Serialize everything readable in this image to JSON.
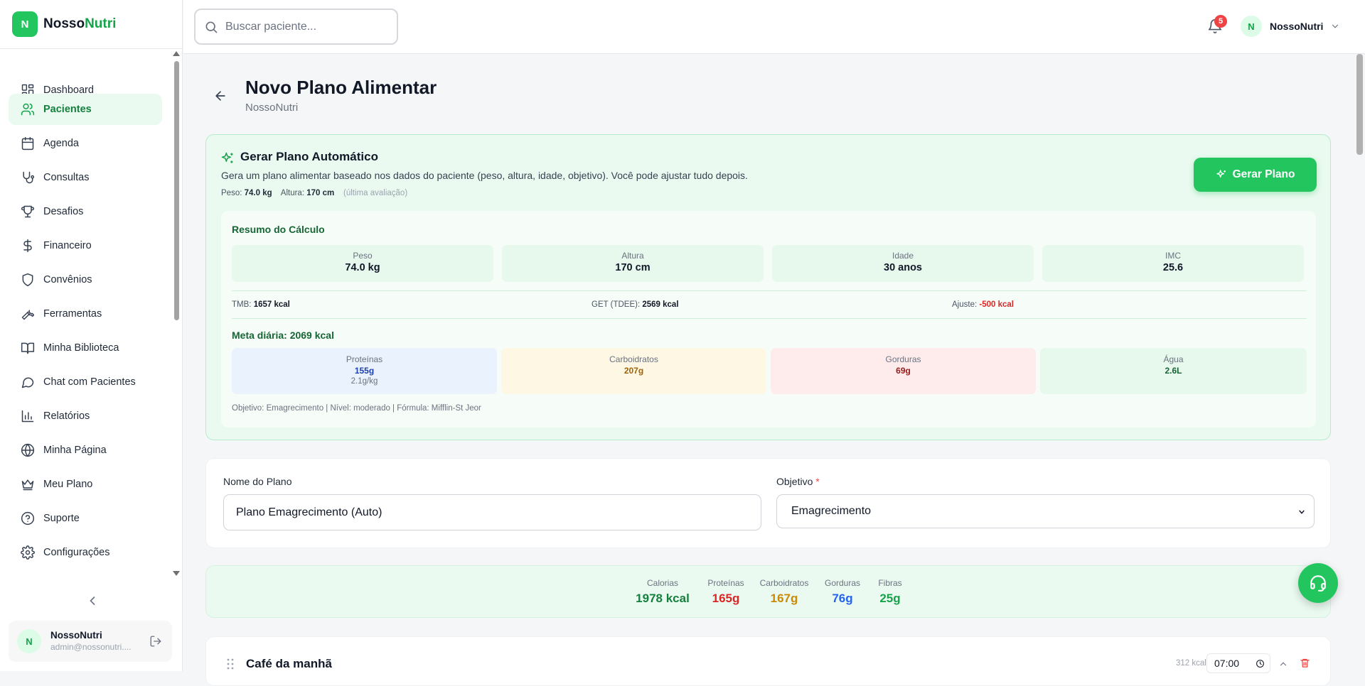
{
  "brand": {
    "logo_letter": "N",
    "name_part1": "Nosso",
    "name_part2": "Nutri"
  },
  "sidebar": {
    "items": [
      {
        "label": "Dashboard",
        "icon": "grid-icon"
      },
      {
        "label": "Pacientes",
        "icon": "users-icon",
        "active": true
      },
      {
        "label": "Agenda",
        "icon": "calendar-icon"
      },
      {
        "label": "Consultas",
        "icon": "stethoscope-icon"
      },
      {
        "label": "Desafios",
        "icon": "trophy-icon"
      },
      {
        "label": "Financeiro",
        "icon": "dollar-icon"
      },
      {
        "label": "Convênios",
        "icon": "shield-icon"
      },
      {
        "label": "Ferramentas",
        "icon": "wrench-icon"
      },
      {
        "label": "Minha Biblioteca",
        "icon": "book-icon"
      },
      {
        "label": "Chat com Pacientes",
        "icon": "chat-icon"
      },
      {
        "label": "Relatórios",
        "icon": "bar-chart-icon"
      },
      {
        "label": "Minha Página",
        "icon": "globe-icon"
      },
      {
        "label": "Meu Plano",
        "icon": "crown-icon"
      },
      {
        "label": "Suporte",
        "icon": "help-circle-icon"
      },
      {
        "label": "Configurações",
        "icon": "gear-icon"
      }
    ],
    "user": {
      "initial": "N",
      "name": "NossoNutri",
      "email": "admin@nossonutri...."
    }
  },
  "topbar": {
    "search_placeholder": "Buscar paciente...",
    "notifications_count": "5",
    "user_initial": "N",
    "user_name": "NossoNutri"
  },
  "page": {
    "title": "Novo Plano Alimentar",
    "subtitle": "NossoNutri"
  },
  "auto_plan": {
    "title": "Gerar Plano Automático",
    "description": "Gera um plano alimentar baseado nos dados do paciente (peso, altura, idade, objetivo). Você pode ajustar tudo depois.",
    "weight_label": "Peso:",
    "weight_value": "74.0 kg",
    "height_label": "Altura:",
    "height_value": "170 cm",
    "source_note": "(última avaliação)",
    "button_label": "Gerar Plano",
    "summary": {
      "title": "Resumo do Cálculo",
      "stats": [
        {
          "label": "Peso",
          "value": "74.0 kg"
        },
        {
          "label": "Altura",
          "value": "170 cm"
        },
        {
          "label": "Idade",
          "value": "30 anos"
        },
        {
          "label": "IMC",
          "value": "25.6"
        }
      ],
      "tmb_label": "TMB:",
      "tmb_value": "1657 kcal",
      "get_label": "GET (TDEE):",
      "get_value": "2569 kcal",
      "adjust_label": "Ajuste:",
      "adjust_value": "-500 kcal",
      "daily_goal": "Meta diária: 2069 kcal",
      "macros": [
        {
          "label": "Proteínas",
          "value": "155g",
          "sub": "2.1g/kg",
          "color": "#1e40af",
          "bg": "#eaf2fd"
        },
        {
          "label": "Carboidratos",
          "value": "207g",
          "sub": "",
          "color": "#a16207",
          "bg": "#fdf7e3"
        },
        {
          "label": "Gorduras",
          "value": "69g",
          "sub": "",
          "color": "#991b1b",
          "bg": "#fdeceb"
        },
        {
          "label": "Água",
          "value": "2.6L",
          "sub": "",
          "color": "#166534",
          "bg": "#e7f8ed"
        }
      ],
      "footer": "Objetivo: Emagrecimento | Nível: moderado | Fórmula: Mifflin-St Jeor"
    }
  },
  "plan_form": {
    "name_label": "Nome do Plano",
    "name_value": "Plano Emagrecimento (Auto)",
    "objective_label": "Objetivo",
    "objective_required": "*",
    "objective_value": "Emagrecimento"
  },
  "totals": [
    {
      "label": "Calorias",
      "value": "1978 kcal",
      "color": "#15803d"
    },
    {
      "label": "Proteínas",
      "value": "165g",
      "color": "#dc2626"
    },
    {
      "label": "Carboidratos",
      "value": "167g",
      "color": "#ca8a04"
    },
    {
      "label": "Gorduras",
      "value": "76g",
      "color": "#2563eb"
    },
    {
      "label": "Fibras",
      "value": "25g",
      "color": "#16a34a"
    }
  ],
  "meal": {
    "name": "Café da manhã",
    "kcal": "312 kcal",
    "time": "07:00"
  },
  "colors": {
    "primary": "#22c55e",
    "primary_dark": "#16a34a",
    "danger": "#ef4444"
  }
}
